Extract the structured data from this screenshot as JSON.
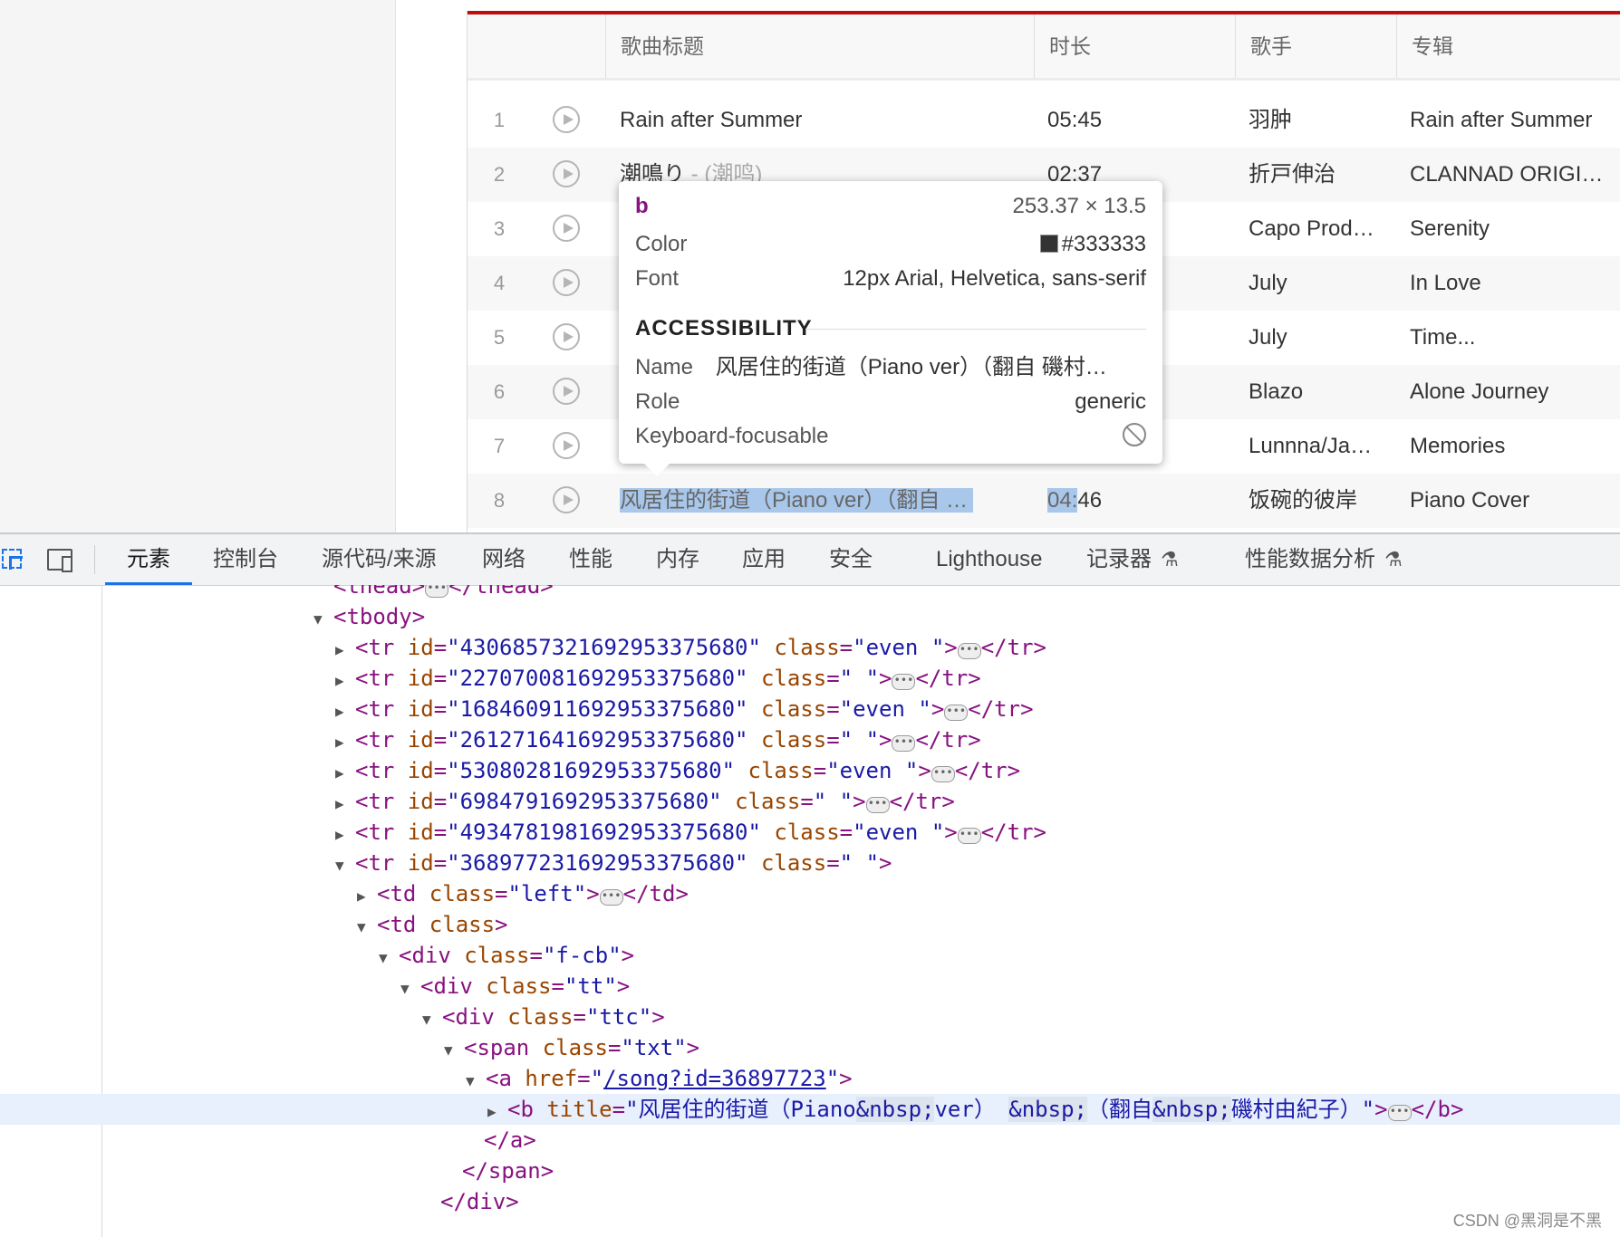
{
  "song_table": {
    "headers": {
      "title": "歌曲标题",
      "duration": "时长",
      "artist": "歌手",
      "album": "专辑"
    },
    "rows": [
      {
        "num": "1",
        "title": "Rain after Summer",
        "sub": "",
        "duration": "05:45",
        "artist": "羽肿",
        "album": "Rain after Summer"
      },
      {
        "num": "2",
        "title": "潮鳴り",
        "sub": " - (潮鸣)",
        "duration": "02:37",
        "artist": "折戸伸治",
        "album": "CLANNAD ORIGI…"
      },
      {
        "num": "3",
        "title": "",
        "sub": "",
        "duration": "",
        "artist": "Capo Prod…",
        "album": "Serenity"
      },
      {
        "num": "4",
        "title": "",
        "sub": "",
        "duration": "",
        "artist": "July",
        "album": "In Love"
      },
      {
        "num": "5",
        "title": "",
        "sub": "",
        "duration": "",
        "artist": "July",
        "album": "Time..."
      },
      {
        "num": "6",
        "title": "",
        "sub": "",
        "duration": "",
        "artist": "Blazo",
        "album": "Alone Journey"
      },
      {
        "num": "7",
        "title": "",
        "sub": "",
        "duration": "",
        "artist": "Lunnna/Ja…",
        "album": "Memories"
      },
      {
        "num": "8",
        "title": "风居住的街道（Piano ver）（翻自 …",
        "sub": "",
        "duration_hl": "04:",
        "duration_rest": "46",
        "artist": "饭碗的彼岸",
        "album": "Piano Cover"
      }
    ]
  },
  "tooltip": {
    "tag": "b",
    "size": "253.37 × 13.5",
    "color_label": "Color",
    "color_value": "#333333",
    "font_label": "Font",
    "font_value": "12px Arial, Helvetica, sans-serif",
    "accessibility_heading": "ACCESSIBILITY",
    "name_label": "Name",
    "name_value": "风居住的街道（Piano ver）（翻自 磯村…",
    "role_label": "Role",
    "role_value": "generic",
    "keyboard_label": "Keyboard-focusable"
  },
  "devtools": {
    "tabs": [
      "元素",
      "控制台",
      "源代码/来源",
      "网络",
      "性能",
      "内存",
      "应用",
      "安全",
      "Lighthouse",
      "记录器",
      "性能数据分析"
    ],
    "flask": "⚗"
  },
  "dom": {
    "thead": "<thead>",
    "thead_close": "</thead>",
    "tbody": "<tbody>",
    "rows": [
      {
        "id": "430685732169295337568​0",
        "cls": "even "
      },
      {
        "id": "22707008169295337568​0",
        "cls": " "
      },
      {
        "id": "16846091169295337568​0",
        "cls": "even "
      },
      {
        "id": "26127164169295337568​0",
        "cls": " "
      },
      {
        "id": "5308028169295337568​0",
        "cls": "even "
      },
      {
        "id": "698479169295337568​0",
        "cls": " "
      },
      {
        "id": "493478198169295337568​0",
        "cls": "even "
      },
      {
        "id": "36897723169295337568​0",
        "cls": " "
      }
    ],
    "td_left": "left",
    "div_fcb": "f-cb",
    "div_tt": "tt",
    "div_ttc": "ttc",
    "span_txt": "txt",
    "href": "/song?id=36897723",
    "b_title_1": "风居住的街道（Piano",
    "b_title_nbsp1": "&nbsp;",
    "b_title_2": "ver）",
    "b_title_nbsp2": "&nbsp;",
    "b_title_3": "（翻自",
    "b_title_nbsp3": "&nbsp;",
    "b_title_4": "磯村由紀子）\""
  },
  "watermark": "CSDN @黑洞是不黑"
}
